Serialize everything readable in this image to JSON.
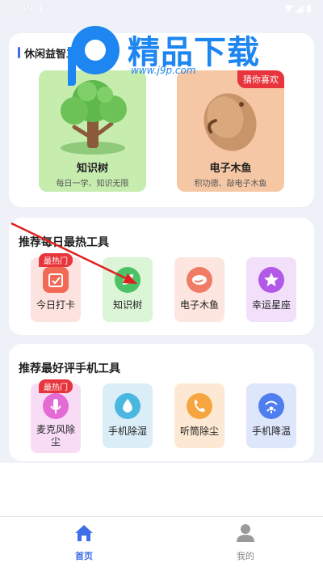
{
  "status_bar": {
    "time": "9:49",
    "download_icon": "download-icon",
    "icons": [
      "wifi-icon",
      "signal-icon",
      "battery-icon"
    ]
  },
  "watermark": {
    "title": "精品下载",
    "url": "www.j9p.com"
  },
  "leisure_section": {
    "title": "休闲益智工具",
    "cards": [
      {
        "name": "知识树",
        "desc": "每日一学、知识无限",
        "bg": "#c6ecae",
        "icon": "tree-icon"
      },
      {
        "name": "电子木鱼",
        "desc": "积功德、敲电子木鱼",
        "bg": "#f6c7a4",
        "icon": "wooden-fish-icon",
        "badge": "猜你喜欢"
      }
    ]
  },
  "daily_section": {
    "title": "推荐每日最热工具",
    "tools": [
      {
        "label": "今日打卡",
        "icon": "calendar-check-icon",
        "bg": "#fde3e0",
        "icon_color": "#f26a55",
        "badge": "最热门"
      },
      {
        "label": "知识树",
        "icon": "leaf-icon",
        "bg": "#dcf5d6",
        "icon_color": "#4cc267"
      },
      {
        "label": "电子木鱼",
        "icon": "wooden-fish-icon",
        "bg": "#fde6df",
        "icon_color": "#f07c66"
      },
      {
        "label": "幸运星座",
        "icon": "star-icon",
        "bg": "#f2e0fb",
        "icon_color": "#b259e8"
      }
    ]
  },
  "phone_section": {
    "title": "推荐最好评手机工具",
    "tools": [
      {
        "label": "麦克风除尘",
        "icon": "microphone-icon",
        "bg": "#f8dcf6",
        "icon_color": "#e46ad4",
        "badge": "最热门"
      },
      {
        "label": "手机除湿",
        "icon": "water-drop-icon",
        "bg": "#dbeef7",
        "icon_color": "#4ab7e0"
      },
      {
        "label": "听筒除尘",
        "icon": "phone-icon",
        "bg": "#fde9d3",
        "icon_color": "#f5a640"
      },
      {
        "label": "手机降温",
        "icon": "fan-icon",
        "bg": "#dde6fb",
        "icon_color": "#4f7ef0"
      }
    ]
  },
  "bottom_nav": [
    {
      "label": "首页",
      "icon": "home-icon",
      "active": true
    },
    {
      "label": "我的",
      "icon": "person-icon",
      "active": false
    }
  ],
  "colors": {
    "accent": "#3f6ee8",
    "hot_badge": "#e8343c",
    "background": "#eef2f8"
  }
}
